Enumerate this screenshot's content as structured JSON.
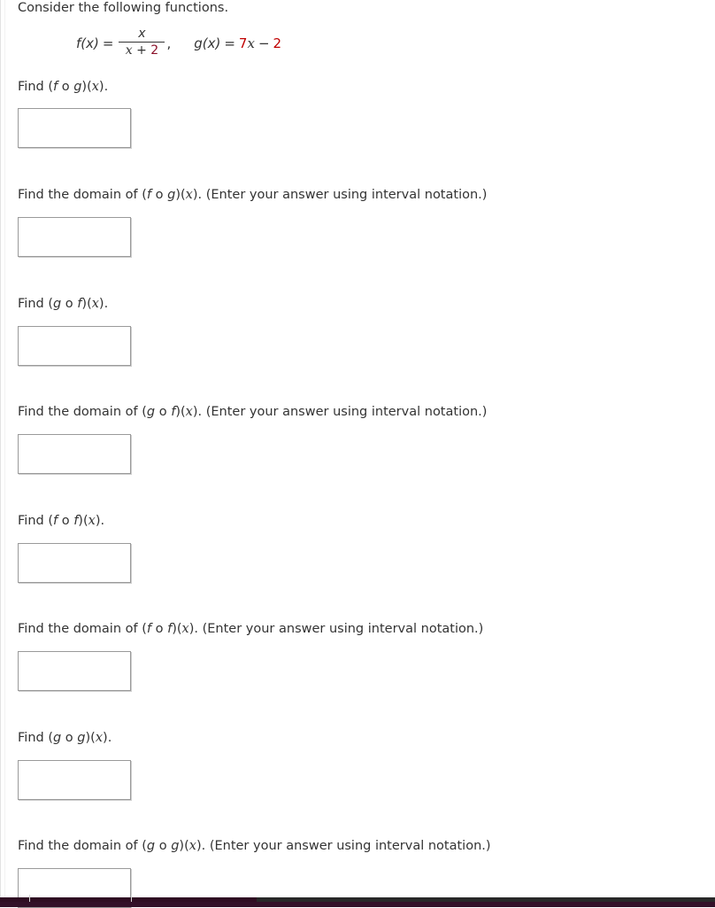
{
  "document": {
    "intro": "Consider the following functions.",
    "formula": {
      "f_name": "f(x)",
      "f_equals": "=",
      "f_numerator": "x",
      "f_denominator_x": "x",
      "f_denominator_plus": "+",
      "f_denominator_const": "2",
      "f_comma": ",",
      "g_name": "g(x)",
      "g_equals": "=",
      "g_coefficient": "7",
      "g_variable": "x",
      "g_minus": "−",
      "g_constant": "2",
      "accent_red": "#c00000",
      "accent_darkred": "#8a1028"
    },
    "questions": [
      {
        "id": "fog",
        "text": "Find (f o g)(x).",
        "parts": {
          "lead": "Find (",
          "first": "f",
          "circ": " o ",
          "second": "g",
          "close": ")(",
          "var": "x",
          "tail": ")."
        },
        "answer_value": "",
        "answer_placeholder": ""
      },
      {
        "id": "fog-domain",
        "text": "Find the domain of (f o g)(x). (Enter your answer using interval notation.)",
        "parts": {
          "lead": "Find the domain of (",
          "first": "f",
          "circ": " o ",
          "second": "g",
          "close": ")(",
          "var": "x",
          "tail": "). (Enter your answer using interval notation.)"
        },
        "answer_value": "",
        "answer_placeholder": ""
      },
      {
        "id": "gof",
        "text": "Find (g o f)(x).",
        "parts": {
          "lead": "Find (",
          "first": "g",
          "circ": " o ",
          "second": "f",
          "close": ")(",
          "var": "x",
          "tail": ")."
        },
        "answer_value": "",
        "answer_placeholder": ""
      },
      {
        "id": "gof-domain",
        "text": "Find the domain of (g o f)(x). (Enter your answer using interval notation.)",
        "parts": {
          "lead": "Find the domain of (",
          "first": "g",
          "circ": " o ",
          "second": "f",
          "close": ")(",
          "var": "x",
          "tail": "). (Enter your answer using interval notation.)"
        },
        "answer_value": "",
        "answer_placeholder": ""
      },
      {
        "id": "fof",
        "text": "Find (f o f)(x).",
        "parts": {
          "lead": "Find (",
          "first": "f",
          "circ": " o ",
          "second": "f",
          "close": ")(",
          "var": "x",
          "tail": ")."
        },
        "answer_value": "",
        "answer_placeholder": ""
      },
      {
        "id": "fof-domain",
        "text": "Find the domain of (f o f)(x). (Enter your answer using interval notation.)",
        "parts": {
          "lead": "Find the domain of (",
          "first": "f",
          "circ": " o ",
          "second": "f",
          "close": ")(",
          "var": "x",
          "tail": "). (Enter your answer using interval notation.)"
        },
        "answer_value": "",
        "answer_placeholder": ""
      },
      {
        "id": "gog",
        "text": "Find (g o g)(x).",
        "parts": {
          "lead": "Find (",
          "first": "g",
          "circ": " o ",
          "second": "g",
          "close": ")(",
          "var": "x",
          "tail": ")."
        },
        "answer_value": "",
        "answer_placeholder": ""
      },
      {
        "id": "gog-domain",
        "text": "Find the domain of (g o g)(x). (Enter your answer using interval notation.)",
        "parts": {
          "lead": "Find the domain of (",
          "first": "g",
          "circ": " o ",
          "second": "g",
          "close": ")(",
          "var": "x",
          "tail": "). (Enter your answer using interval notation.)"
        },
        "answer_value": "",
        "answer_placeholder": ""
      }
    ]
  }
}
